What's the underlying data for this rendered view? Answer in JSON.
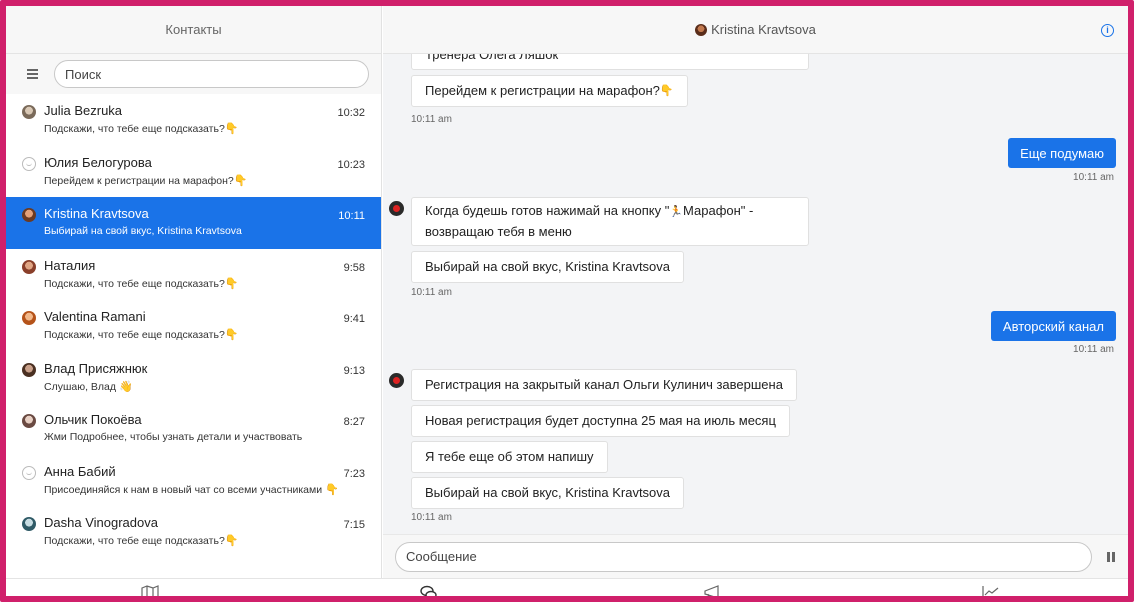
{
  "sidebar": {
    "title": "Контакты",
    "search_placeholder": "Поиск",
    "contacts": [
      {
        "name": "Julia Bezruka",
        "time": "10:32",
        "preview": "Подскажи, что тебе еще подсказать?",
        "emoji": "👇",
        "avatar": "#9a8b7a"
      },
      {
        "name": "Юлия Белогурова",
        "time": "10:23",
        "preview": "Перейдем к регистрации на марафон?",
        "emoji": "👇",
        "avatar": "blank"
      },
      {
        "name": "Kristina Kravtsova",
        "time": "10:11",
        "preview": "Выбирай на свой вкус, Kristina Kravtsova",
        "emoji": "",
        "avatar": "#c2794e",
        "active": true
      },
      {
        "name": "Наталия",
        "time": "9:58",
        "preview": "Подскажи, что тебе еще подсказать?",
        "emoji": "👇",
        "avatar": "#b5654a"
      },
      {
        "name": "Valentina Ramani",
        "time": "9:41",
        "preview": "Подскажи, что тебе еще подсказать?",
        "emoji": "👇",
        "avatar": "#c85a22"
      },
      {
        "name": "Влад Присяжнюк",
        "time": "9:13",
        "preview": "Слушаю, Влад",
        "emoji": "👋",
        "avatar": "#7a5a48"
      },
      {
        "name": "Ольчик Покоёва",
        "time": "8:27",
        "preview": "Жми Подробнее, чтобы узнать детали и участвовать",
        "emoji": "",
        "avatar": "#8a6f68"
      },
      {
        "name": "Анна Бабий",
        "time": "7:23",
        "preview": "Присоединяйся к нам в новый чат со всеми участниками",
        "emoji": "👇",
        "avatar": "blank"
      },
      {
        "name": "Dasha Vinogradova",
        "time": "7:15",
        "preview": "Подскажи, что тебе еще подсказать?",
        "emoji": "👇",
        "avatar": "#4a7a8a"
      }
    ]
  },
  "chat": {
    "contact_name": "Kristina Kravtsova",
    "composer_placeholder": "Сообщение",
    "messages": {
      "m0": "Тренера Олега Ляшок",
      "m1": "Перейдем к регистрации на марафон?",
      "m1_emoji": "👇",
      "t1": "10:11 am",
      "out1": "Еще подумаю",
      "t2": "10:11 am",
      "m2_line1a": "Когда будешь готов нажимай на кнопку \"",
      "m2_emoji": "🏃",
      "m2_line1b": "Марафон\" -",
      "m2_line2": "возвращаю тебя в меню",
      "m3": "Выбирай на свой вкус, Kristina Kravtsova",
      "t3": "10:11 am",
      "out2": "Авторский канал",
      "t4": "10:11 am",
      "m4": "Регистрация на закрытый канал Ольги Кулинич завершена",
      "m5": "Новая регистрация будет доступна 25 мая на июль месяц",
      "m6": "Я тебе еще об этом напишу",
      "m7": "Выбирай на свой вкус, Kristina Kravtsova",
      "t5": "10:11 am"
    }
  },
  "icons": {
    "menu": "hamburger-icon",
    "info": "info-icon",
    "pause": "pause-icon",
    "tabs": [
      "map-icon",
      "chat-bubbles-icon",
      "megaphone-icon",
      "chart-icon"
    ]
  },
  "colors": {
    "accent": "#1a73e8",
    "frame": "#d0206b"
  }
}
